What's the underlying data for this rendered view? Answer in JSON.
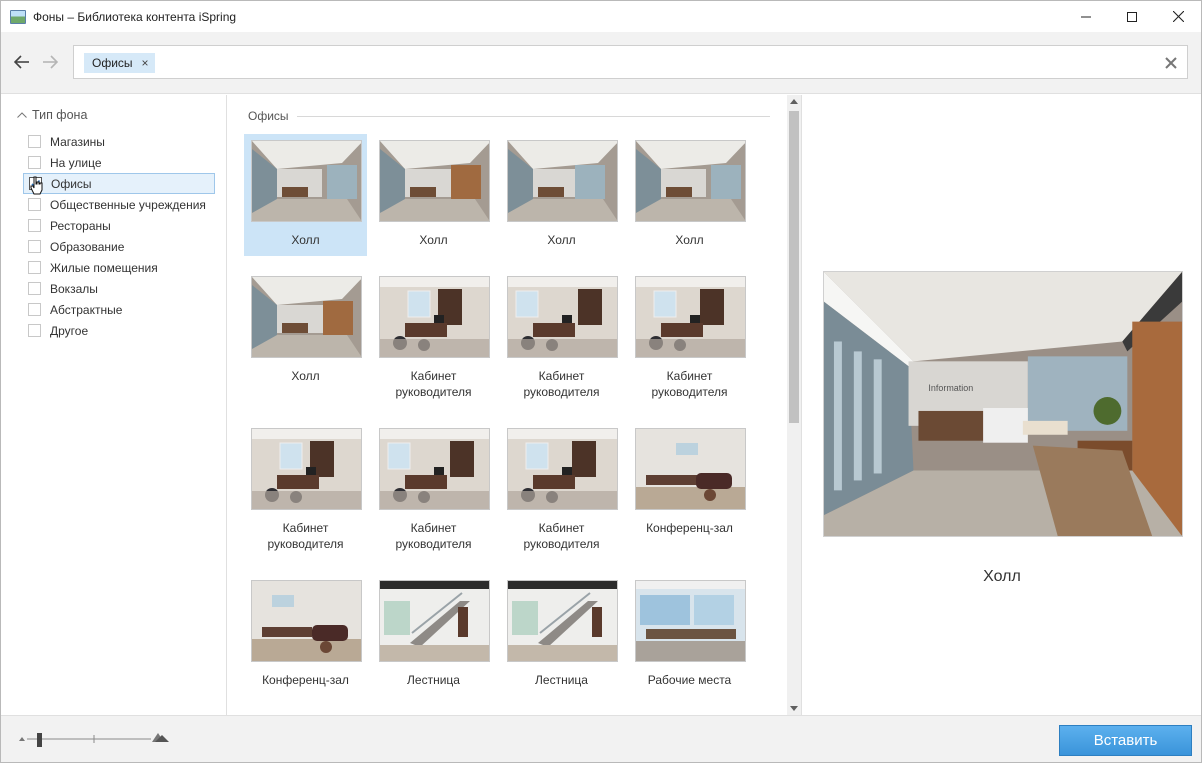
{
  "window": {
    "title": "Фоны – Библиотека контента iSpring",
    "controls": [
      "minimize-icon",
      "maximize-icon",
      "close-icon"
    ]
  },
  "toolbar": {
    "back_icon": "arrow-left-icon",
    "forward_icon": "arrow-right-icon",
    "search_tag": "Офисы",
    "tag_close_glyph": "×",
    "clear_icon": "clear-x-icon"
  },
  "sidebar": {
    "heading": "Тип фона",
    "items": [
      {
        "label": "Магазины",
        "checked": false
      },
      {
        "label": "На улице",
        "checked": false
      },
      {
        "label": "Офисы",
        "checked": true
      },
      {
        "label": "Общественные учреждения",
        "checked": false
      },
      {
        "label": "Рестораны",
        "checked": false
      },
      {
        "label": "Образование",
        "checked": false
      },
      {
        "label": "Жилые помещения",
        "checked": false
      },
      {
        "label": "Вокзалы",
        "checked": false
      },
      {
        "label": "Абстрактные",
        "checked": false
      },
      {
        "label": "Другое",
        "checked": false
      }
    ]
  },
  "grid": {
    "section_title": "Офисы",
    "tiles": [
      {
        "label": "Холл",
        "scene": "hall",
        "selected": true
      },
      {
        "label": "Холл",
        "scene": "hall",
        "selected": false
      },
      {
        "label": "Холл",
        "scene": "hall",
        "selected": false
      },
      {
        "label": "Холл",
        "scene": "hall",
        "selected": false
      },
      {
        "label": "Холл",
        "scene": "hall",
        "selected": false
      },
      {
        "label": "Кабинет руководителя",
        "scene": "cabinet",
        "selected": false
      },
      {
        "label": "Кабинет руководителя",
        "scene": "cabinet",
        "selected": false
      },
      {
        "label": "Кабинет руководителя",
        "scene": "cabinet",
        "selected": false
      },
      {
        "label": "Кабинет руководителя",
        "scene": "cabinet",
        "selected": false
      },
      {
        "label": "Кабинет руководителя",
        "scene": "cabinet",
        "selected": false
      },
      {
        "label": "Кабинет руководителя",
        "scene": "cabinet",
        "selected": false
      },
      {
        "label": "Конференц-зал",
        "scene": "conference",
        "selected": false
      },
      {
        "label": "Конференц-зал",
        "scene": "conference",
        "selected": false
      },
      {
        "label": "Лестница",
        "scene": "stairs",
        "selected": false
      },
      {
        "label": "Лестница",
        "scene": "stairs",
        "selected": false
      },
      {
        "label": "Рабочие места",
        "scene": "workplaces",
        "selected": false
      }
    ]
  },
  "preview": {
    "label": "Холл",
    "image_sign": "Information"
  },
  "footer": {
    "zoom_icon_small": "mountain-small-icon",
    "zoom_icon_large": "mountain-large-icon",
    "zoom_level": 0.1,
    "insert_label": "Вставить"
  },
  "colors": {
    "accent": "#3a94da",
    "selection": "#cce4f7",
    "tag": "#d6e9f8"
  }
}
